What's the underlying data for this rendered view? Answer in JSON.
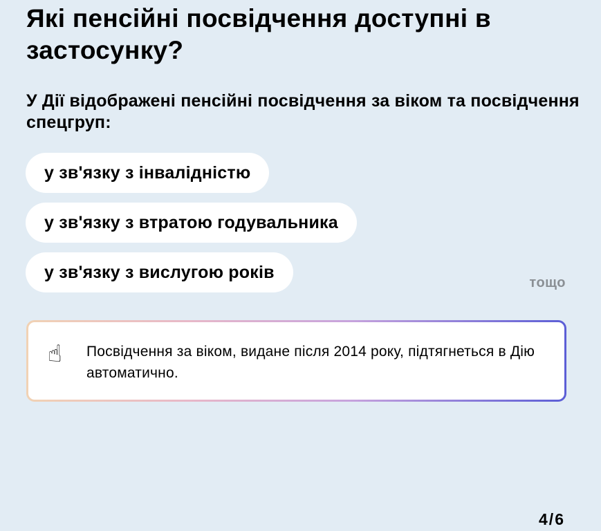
{
  "header": {
    "title": "Які пенсійні посвідчення доступні в застосунку?"
  },
  "intro": {
    "text": "У Дії відображені пенсійні посвідчення за віком та посвідчення спецгруп:"
  },
  "categories": [
    {
      "label": "у зв'язку з інвалідністю"
    },
    {
      "label": "у зв'язку з втратою годувальника"
    },
    {
      "label": "у зв'язку з вислугою років"
    }
  ],
  "more_label": "тощо",
  "notice": {
    "icon": "☝",
    "icon_name": "pointing-up-hand-icon",
    "text": "Посвідчення за віком, видане після 2014 року, підтягнеться в Дію автоматично."
  },
  "pager": {
    "text": "4/6"
  },
  "colors": {
    "background": "#e2ecf4",
    "chip": "#ffffff",
    "muted_text": "#8a8f94",
    "gradient_start": "#f1d2b4",
    "gradient_end": "#5b5ed6"
  }
}
